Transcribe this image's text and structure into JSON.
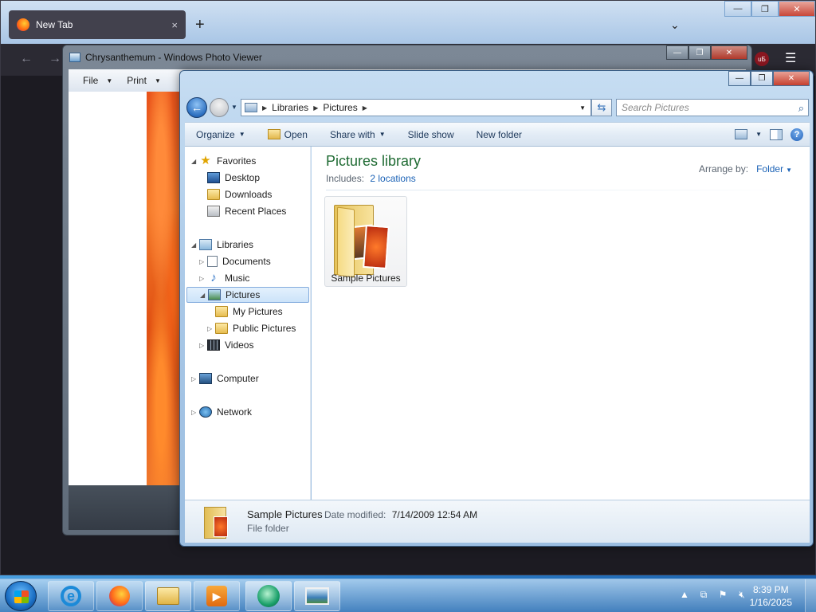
{
  "firefox": {
    "tab_title": "New Tab",
    "tab_close": "×",
    "new_tab": "+",
    "list_all_tabs": "⌄",
    "back": "←",
    "forward": "→",
    "menu": "☰",
    "ublock_badge": "uБ"
  },
  "window_controls": {
    "minimize": "—",
    "maximize": "❐",
    "close": "✕"
  },
  "photo_viewer": {
    "title": "Chrysanthemum - Windows Photo Viewer",
    "menu": {
      "file": "File",
      "print": "Print"
    }
  },
  "explorer": {
    "address": {
      "root": "Libraries",
      "current": "Pictures"
    },
    "search_placeholder": "Search Pictures",
    "toolbar": {
      "organize": "Organize",
      "open": "Open",
      "share_with": "Share with",
      "slide_show": "Slide show",
      "new_folder": "New folder",
      "help": "?"
    },
    "nav": {
      "favorites": "Favorites",
      "desktop": "Desktop",
      "downloads": "Downloads",
      "recent_places": "Recent Places",
      "libraries": "Libraries",
      "documents": "Documents",
      "music": "Music",
      "pictures": "Pictures",
      "my_pictures": "My Pictures",
      "public_pictures": "Public Pictures",
      "videos": "Videos",
      "computer": "Computer",
      "network": "Network"
    },
    "library": {
      "title": "Pictures library",
      "includes_label": "Includes:",
      "includes_link": "2 locations",
      "arrange_label": "Arrange by:",
      "arrange_value": "Folder"
    },
    "items": [
      {
        "name": "Sample Pictures"
      }
    ],
    "details": {
      "name": "Sample Pictures",
      "modified_label": "Date modified:",
      "modified_value": "7/14/2009 12:54 AM",
      "type": "File folder"
    }
  },
  "taskbar": {
    "clock_time": "8:39 PM",
    "clock_date": "1/16/2025",
    "tray_arrow": "▲"
  }
}
